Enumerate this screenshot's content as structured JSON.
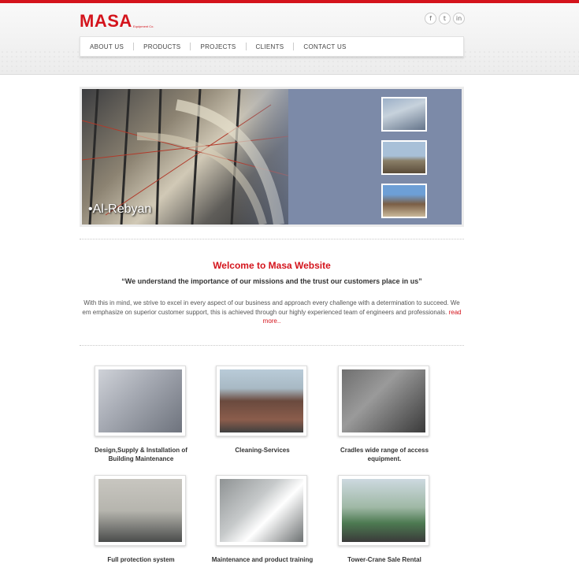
{
  "brand": {
    "name": "MASA",
    "tagline": "Equipment Co.",
    "accent_color": "#d4141c"
  },
  "social": [
    {
      "icon": "facebook-icon",
      "glyph": "f"
    },
    {
      "icon": "twitter-icon",
      "glyph": "t"
    },
    {
      "icon": "linkedin-icon",
      "glyph": "in"
    }
  ],
  "nav": {
    "items": [
      "ABOUT US",
      "PRODUCTS",
      "PROJECTS",
      "CLIENTS",
      "CONTACT US"
    ]
  },
  "slider": {
    "caption": "•Al-Rebyan"
  },
  "welcome": {
    "title": "Welcome to Masa Website",
    "quote": "“We understand the importance of our missions and the trust our customers place in us”",
    "body": "With this in mind, we strive to excel in every aspect of our business and approach every challenge with a determination to succeed. We em emphasize on superior customer support, this is achieved through our highly experienced team of engineers and professionals.",
    "read_more": "read more.."
  },
  "services": [
    {
      "label": "Design,Supply & Installation of Building Maintenance"
    },
    {
      "label": "Cleaning-Services"
    },
    {
      "label": "Cradles wide range of access equipment."
    },
    {
      "label": "Full protection system"
    },
    {
      "label": "Maintenance and product training"
    },
    {
      "label": "Tower-Crane Sale Rental"
    }
  ]
}
